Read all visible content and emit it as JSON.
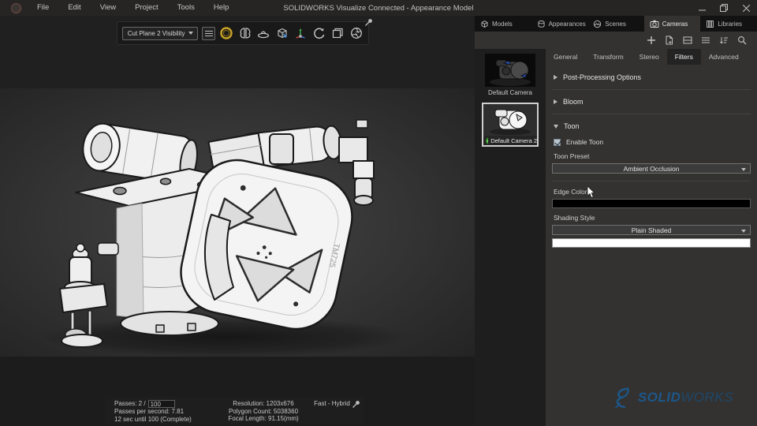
{
  "window": {
    "title": "SOLIDWORKS Visualize Connected - Appearance Model",
    "menus": [
      "File",
      "Edit",
      "View",
      "Project",
      "Tools",
      "Help"
    ]
  },
  "toolbar": {
    "cut_plane_dropdown": "Cut Plane 2 Visibility",
    "icons": [
      "hamburger-icon",
      "gold-ring-icon",
      "split-model-icon",
      "turntable-icon",
      "camera-cube-icon",
      "move-axes-icon",
      "rotate-icon",
      "snapshot-icon",
      "aperture-icon",
      "pin-icon"
    ]
  },
  "right_panel": {
    "tabs": [
      {
        "label": "Models",
        "icon": "cube-icon"
      },
      {
        "label": "Appearances",
        "icon": "material-icon"
      },
      {
        "label": "Scenes",
        "icon": "scene-icon"
      },
      {
        "label": "Cameras",
        "icon": "camera-icon"
      },
      {
        "label": "Libraries",
        "icon": "library-icon"
      }
    ],
    "active_tab": "Cameras",
    "actions": [
      "add-icon",
      "export-icon",
      "split-view-icon",
      "list-icon",
      "sort-icon",
      "search-icon"
    ],
    "cameras": [
      {
        "name": "Default Camera",
        "selected": false
      },
      {
        "name": "Default Camera 2",
        "selected": true
      }
    ],
    "subtabs": [
      "General",
      "Transform",
      "Stereo",
      "Filters",
      "Advanced"
    ],
    "active_subtab": "Filters",
    "filters": {
      "sections": [
        {
          "label": "Post-Processing Options",
          "expanded": false
        },
        {
          "label": "Bloom",
          "expanded": false
        },
        {
          "label": "Toon",
          "expanded": true
        }
      ],
      "toon": {
        "enable_label": "Enable Toon",
        "enabled": true,
        "preset_label": "Toon Preset",
        "preset_value": "Ambient Occlusion",
        "edge_color_label": "Edge Color",
        "edge_color": "#000000",
        "shading_style_label": "Shading Style",
        "shading_style_value": "Plain Shaded",
        "shading_color": "#ffffff"
      }
    }
  },
  "status_overlay": {
    "passes_prefix": "Passes: 2 /",
    "passes_value": "100",
    "passes_per_second": "Passes per second: 7.81",
    "eta": "12 sec until 100 (Complete)",
    "resolution": "Resolution: 1203x676",
    "polygon_count": "Polygon Count: 5038360",
    "focal_length": "Focal Length: 91.15(mm)",
    "render_mode": "Fast - Hybrid"
  },
  "watermark": {
    "brand_bold": "SOLID",
    "brand_light": "WORKS",
    "color": "#1a5c94"
  },
  "colors": {
    "titlebar": "#262523",
    "panel": "#333231",
    "tabbar": "#121212",
    "viewport_letterbox": "#202020",
    "selected_border": "#cfcfcf",
    "check_green": "#35a52c",
    "gold_icon": "#c9a227"
  }
}
